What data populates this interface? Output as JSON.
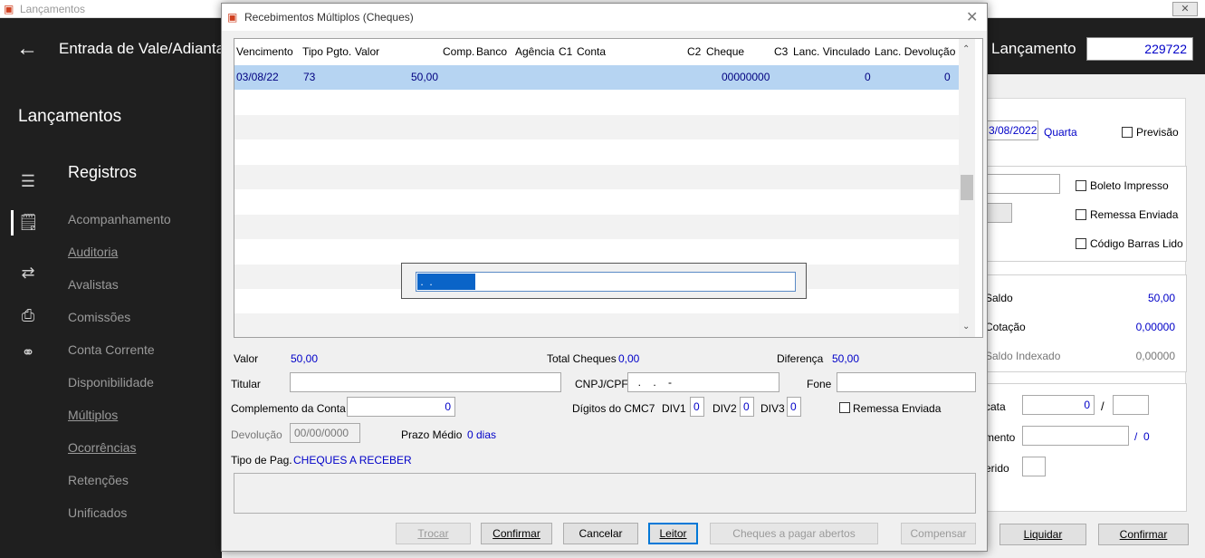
{
  "main_window": {
    "title": "Lançamentos",
    "header_title": "Entrada de Vale/Adianta",
    "lancamento_label": "Lançamento",
    "lancamento_number": "229722",
    "close_glyph": "✕"
  },
  "sidebar": {
    "section_title": "Lançamentos",
    "group_title": "Registros",
    "items": [
      "Acompanhamento",
      "Auditoria",
      "Avalistas",
      "Comissões",
      "Conta Corrente",
      "Disponibilidade",
      "Múltiplos",
      "Ocorrências",
      "Retenções",
      "Unificados"
    ]
  },
  "right_panel": {
    "date": "3/08/2022",
    "weekday": "Quarta",
    "previsao": "Previsão",
    "boleto_impresso": "Boleto Impresso",
    "remessa_enviada": "Remessa Enviada",
    "codigo_barras_lido": "Código Barras Lido",
    "saldo_label": "Saldo",
    "saldo_value": "50,00",
    "cotacao_label": "Cotação",
    "cotacao_value": "0,00000",
    "saldo_indexado_label": "Saldo Indexado",
    "saldo_indexado_value": "0,00000",
    "cata_label": "cata",
    "cata_value": "0",
    "cata_slash": "/",
    "mento_label": "mento",
    "mento_suffix": "/  0",
    "erido_label": "erido",
    "liquidar_button": "Liquidar",
    "confirmar_button": "Confirmar"
  },
  "dialog": {
    "title": "Recebimentos Múltiplos (Cheques)",
    "columns": [
      "Vencimento",
      "Tipo Pgto.",
      "Valor",
      "Comp.",
      "Banco",
      "Agência",
      "C1",
      "Conta",
      "C2",
      "Cheque",
      "C3",
      "Lanc. Vinculado",
      "Lanc. Devolução"
    ],
    "rows": [
      {
        "vencimento": "03/08/22",
        "tipo_pgto": "73",
        "valor": "50,00",
        "cheque": "00000000",
        "lanc_vinculado": "0",
        "lanc_devolucao": "0"
      }
    ],
    "cmc7_input": " .  .",
    "valor_label": "Valor",
    "valor_value": "50,00",
    "total_cheques_label": "Total Cheques",
    "total_cheques_value": "0,00",
    "diferenca_label": "Diferença",
    "diferenca_value": "50,00",
    "titular_label": "Titular",
    "cnpj_label": "CNPJ/CPF",
    "cnpj_value": "  .    .    -",
    "fone_label": "Fone",
    "complemento_label": "Complemento da Conta",
    "complemento_value": "0",
    "digitos_label": "Dígitos do CMC7",
    "div1_label": "DIV1",
    "div1_value": "0",
    "div2_label": "DIV2",
    "div2_value": "0",
    "div3_label": "DIV3",
    "div3_value": "0",
    "remessa_label": "Remessa Enviada",
    "devolucao_label": "Devolução",
    "devolucao_value": "00/00/0000",
    "prazo_label": "Prazo Médio",
    "prazo_value": "0 dias",
    "tipo_pag_label": "Tipo de Pag.",
    "tipo_pag_value": "CHEQUES A RECEBER",
    "buttons": {
      "trocar": "Trocar",
      "confirmar": "Confirmar",
      "cancelar": "Cancelar",
      "leitor": "Leitor",
      "cheques_abertos": "Cheques a pagar abertos",
      "compensar": "Compensar"
    }
  },
  "colors": {
    "accent_blue": "#0000c8",
    "selection": "#b6d4f2",
    "sidebar_bg": "#1f1f1f",
    "input_highlight": "#0a64c8"
  }
}
